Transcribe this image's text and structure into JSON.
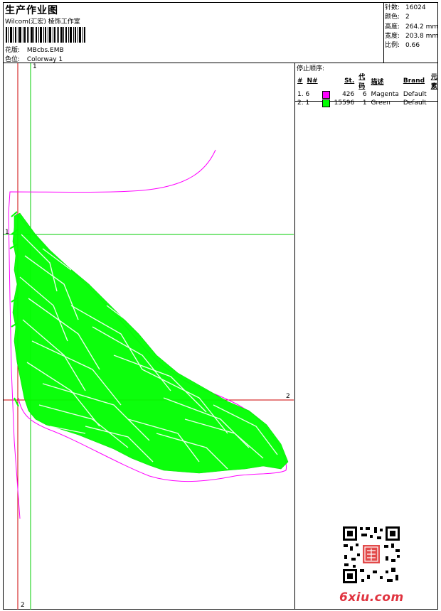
{
  "header": {
    "title": "生产作业图",
    "subtitle": "Wilcom(汇宏) 棱饰工作室",
    "design_label": "花版:",
    "design_value": "MBcbs.EMB",
    "colorway_label": "色位:",
    "colorway_value": "Colorway 1"
  },
  "specs": [
    {
      "label": "针数:",
      "value": "16024"
    },
    {
      "label": "颜色:",
      "value": "2"
    },
    {
      "label": "高度:",
      "value": "264.2 mm"
    },
    {
      "label": "宽度:",
      "value": "203.8 mm"
    },
    {
      "label": "比例:",
      "value": "0.66"
    }
  ],
  "stop_sequence": {
    "title": "停止顺序:",
    "headers": [
      "#",
      "N#",
      "",
      "St.",
      "代码",
      "描述",
      "Brand",
      "元素"
    ],
    "rows": [
      {
        "idx": "1. 6",
        "color": "#ff00ff",
        "stitches": "426",
        "code": "6",
        "desc": "Magenta",
        "brand": "Default"
      },
      {
        "idx": "2. 1",
        "color": "#00ff00",
        "stitches": "15596",
        "code": "1",
        "desc": "Green",
        "brand": "Default"
      }
    ]
  },
  "guides": {
    "v_green": "1",
    "h_green": "1",
    "h_red": "2",
    "v_red": "2"
  },
  "colors": {
    "green": "#00ff00",
    "magenta": "#ff00ff",
    "red": "#cc0000",
    "guide_green": "#00cc00"
  },
  "watermark": {
    "site": "6xiu.com",
    "qr": "qr-code"
  }
}
